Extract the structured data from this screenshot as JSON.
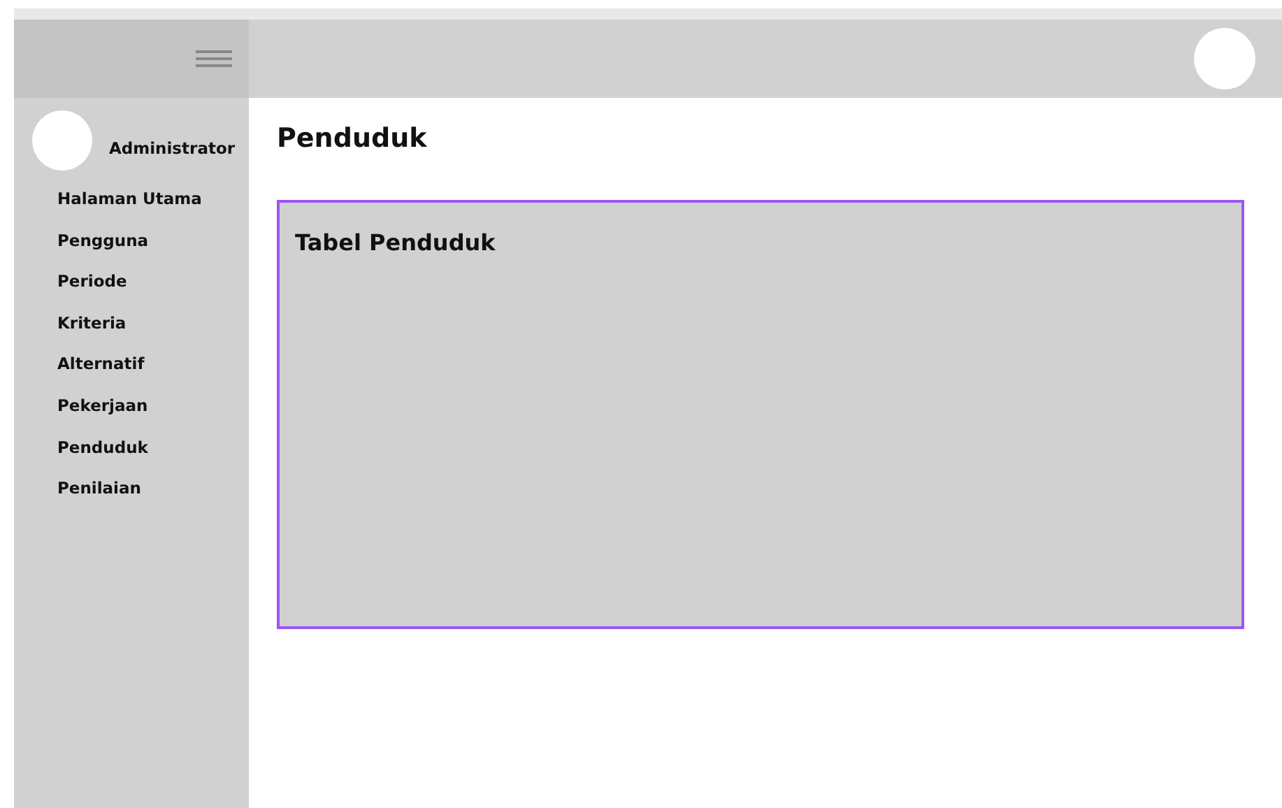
{
  "sidebar": {
    "user": {
      "name": "Administrator"
    },
    "items": [
      {
        "label": "Halaman Utama"
      },
      {
        "label": "Pengguna"
      },
      {
        "label": "Periode"
      },
      {
        "label": "Kriteria"
      },
      {
        "label": "Alternatif"
      },
      {
        "label": "Pekerjaan"
      },
      {
        "label": "Penduduk"
      },
      {
        "label": "Penilaian"
      }
    ]
  },
  "page": {
    "title": "Penduduk",
    "card": {
      "title": "Tabel Penduduk"
    }
  }
}
